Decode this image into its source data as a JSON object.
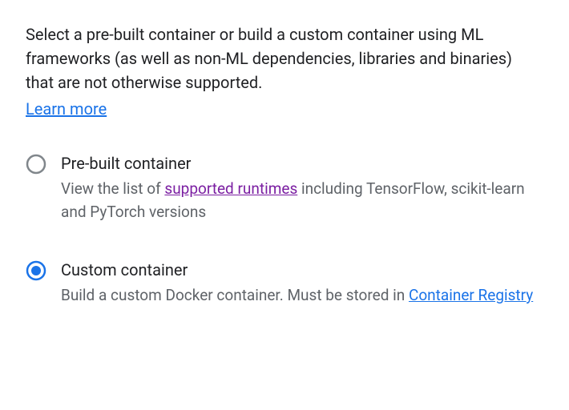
{
  "intro": {
    "text": "Select a pre-built container or build a custom container using ML frameworks (as well as non-ML dependencies, libraries and binaries) that are not otherwise supported.",
    "learn_more": "Learn more"
  },
  "options": {
    "prebuilt": {
      "label": "Pre-built container",
      "description_prefix": "View the list of ",
      "link_text": "supported runtimes",
      "description_suffix": " including TensorFlow, scikit-learn and PyTorch versions",
      "selected": false
    },
    "custom": {
      "label": "Custom container",
      "description_prefix": "Build a custom Docker container. Must be stored in ",
      "link_text": "Container Registry",
      "description_suffix": "",
      "selected": true
    }
  }
}
